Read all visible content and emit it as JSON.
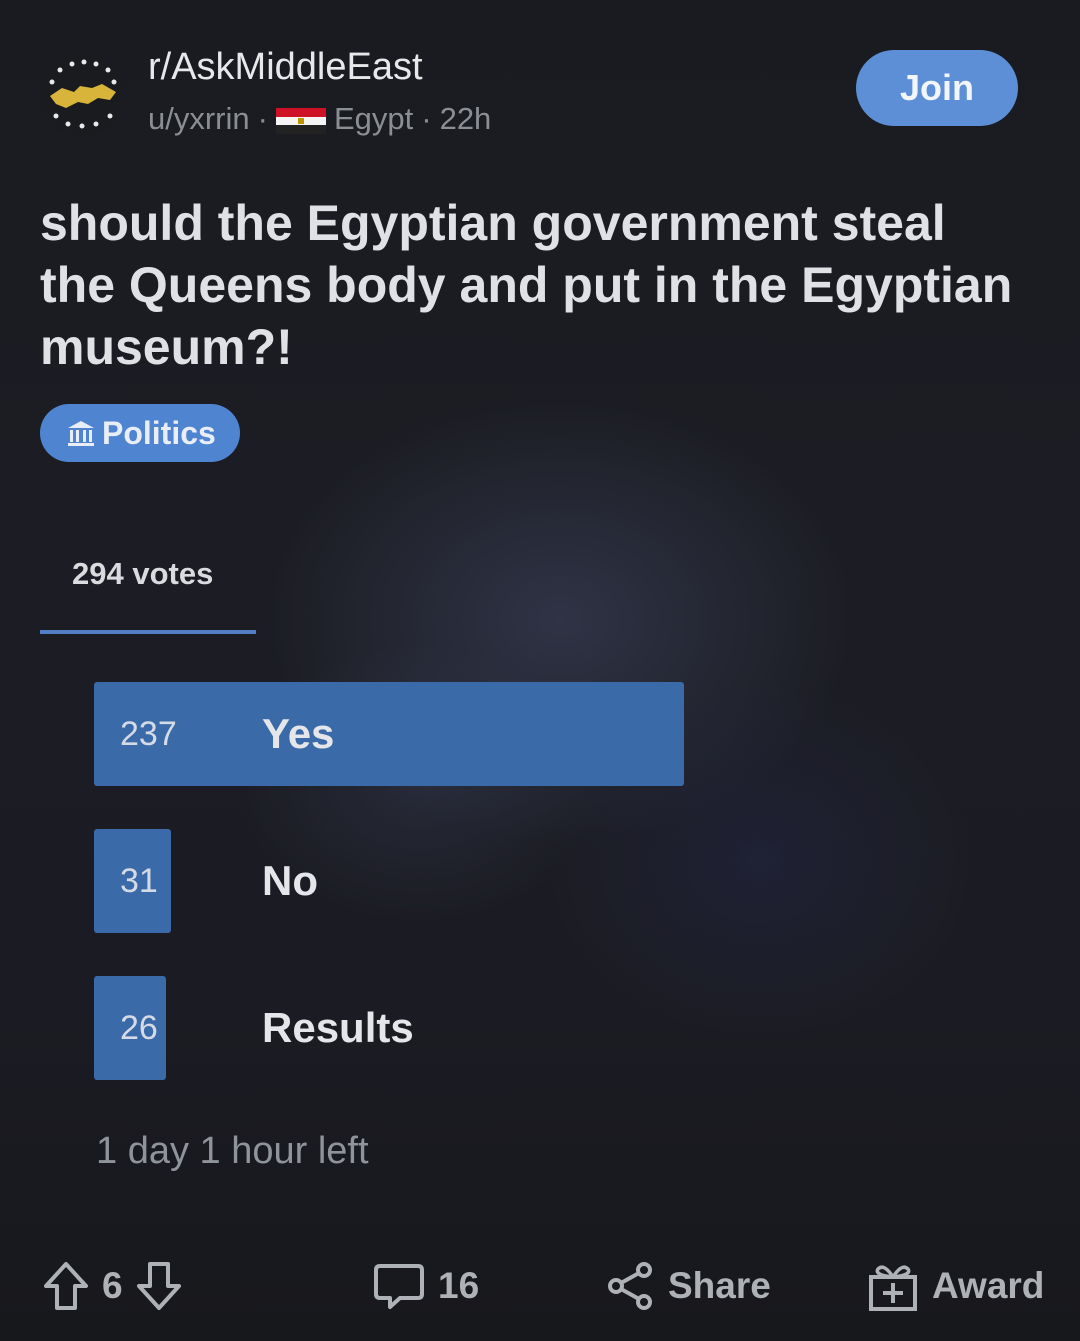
{
  "header": {
    "subreddit": "r/AskMiddleEast",
    "username": "u/yxrrin",
    "separator": "·",
    "flair_country": "Egypt",
    "age": "22h",
    "join_label": "Join"
  },
  "post": {
    "title": "should the Egyptian government steal the Queens body and put in the Egyptian museum?!",
    "flair": "Politics"
  },
  "poll": {
    "votes_label": "294 votes",
    "options": [
      {
        "count": "237",
        "label": "Yes",
        "fraction": 0.806
      },
      {
        "count": "31",
        "label": "No",
        "fraction": 0.105
      },
      {
        "count": "26",
        "label": "Results",
        "fraction": 0.088
      }
    ],
    "time_left": "1 day 1 hour left"
  },
  "footer": {
    "score": "6",
    "comments": "16",
    "share_label": "Share",
    "award_label": "Award"
  },
  "colors": {
    "accent": "#5d8fd6",
    "poll_bar": "#3a6aa8",
    "background": "#18191d"
  },
  "icons": [
    "subreddit-avatar-icon",
    "egypt-flag-icon",
    "bank-icon",
    "upvote-icon",
    "downvote-icon",
    "comment-icon",
    "share-icon",
    "award-icon"
  ]
}
